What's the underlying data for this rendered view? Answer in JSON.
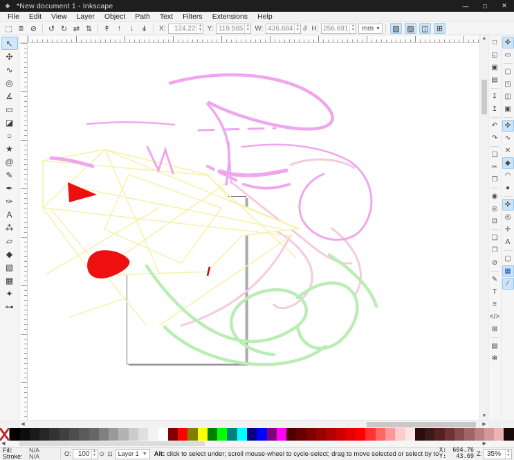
{
  "window": {
    "title": "*New document 1 - Inkscape",
    "controls": [
      {
        "name": "minimize",
        "glyph": "—"
      },
      {
        "name": "maximize",
        "glyph": "□"
      },
      {
        "name": "close",
        "glyph": "✕"
      }
    ]
  },
  "menu": {
    "items": [
      "File",
      "Edit",
      "View",
      "Layer",
      "Object",
      "Path",
      "Text",
      "Filters",
      "Extensions",
      "Help"
    ]
  },
  "toolbar": {
    "buttons": [
      {
        "name": "select-all",
        "glyph": "⬚"
      },
      {
        "name": "select-all-layers",
        "glyph": "⧈"
      },
      {
        "name": "deselect",
        "glyph": "⊘"
      },
      "|",
      {
        "name": "rotate-ccw",
        "glyph": "↺"
      },
      {
        "name": "rotate-cw",
        "glyph": "↻"
      },
      {
        "name": "flip-horizontal",
        "glyph": "⇄"
      },
      {
        "name": "flip-vertical",
        "glyph": "⇅"
      },
      "|",
      {
        "name": "raise-to-top",
        "glyph": "↟"
      },
      {
        "name": "raise",
        "glyph": "↑"
      },
      {
        "name": "lower",
        "glyph": "↓"
      },
      {
        "name": "lower-to-bottom",
        "glyph": "↡"
      }
    ],
    "x_label": "X:",
    "x_value": "124.22",
    "y_label": "Y:",
    "y_value": "119.565",
    "w_label": "W:",
    "w_value": "436.684",
    "h_label": "H:",
    "h_value": "256.691",
    "lock_glyph": "∂",
    "units": "mm",
    "toggles": [
      {
        "name": "scale-stroke",
        "glyph": "▧"
      },
      {
        "name": "scale-corners",
        "glyph": "▨"
      },
      {
        "name": "move-gradients",
        "glyph": "◫"
      },
      {
        "name": "move-patterns",
        "glyph": "⊞"
      }
    ]
  },
  "toolbox": {
    "tools": [
      {
        "name": "selector",
        "glyph": "↖",
        "active": true
      },
      {
        "name": "node-editor",
        "glyph": "✣"
      },
      {
        "name": "tweak",
        "glyph": "∿"
      },
      {
        "name": "zoom",
        "glyph": "◎"
      },
      {
        "name": "measure",
        "glyph": "∡"
      },
      {
        "name": "rectangle",
        "glyph": "▭"
      },
      {
        "name": "box-3d",
        "glyph": "◪"
      },
      {
        "name": "ellipse",
        "glyph": "○"
      },
      {
        "name": "star",
        "glyph": "★"
      },
      {
        "name": "spiral",
        "glyph": "@"
      },
      {
        "name": "pencil",
        "glyph": "✎"
      },
      {
        "name": "bezier-pen",
        "glyph": "✒"
      },
      {
        "name": "calligraphy",
        "glyph": "✑"
      },
      {
        "name": "text",
        "glyph": "A"
      },
      {
        "name": "spray",
        "glyph": "⁂"
      },
      {
        "name": "eraser",
        "glyph": "▱"
      },
      {
        "name": "paint-bucket",
        "glyph": "◆"
      },
      {
        "name": "gradient",
        "glyph": "▧"
      },
      {
        "name": "mesh-gradient",
        "glyph": "▦"
      },
      {
        "name": "dropper",
        "glyph": "✦"
      },
      {
        "name": "connector",
        "glyph": "⊶"
      }
    ]
  },
  "right_commands": {
    "items": [
      {
        "name": "new-document",
        "glyph": "□"
      },
      {
        "name": "open-document",
        "glyph": "◱"
      },
      {
        "name": "save-document",
        "glyph": "▣"
      },
      {
        "name": "print",
        "glyph": "▤"
      },
      "|",
      {
        "name": "import",
        "glyph": "↧"
      },
      {
        "name": "export",
        "glyph": "↥"
      },
      "|",
      {
        "name": "undo",
        "glyph": "↶"
      },
      {
        "name": "redo",
        "glyph": "↷"
      },
      "|",
      {
        "name": "copy",
        "glyph": "❏"
      },
      {
        "name": "cut",
        "glyph": "✂"
      },
      {
        "name": "paste",
        "glyph": "❐"
      },
      "|",
      {
        "name": "zoom-to-selection",
        "glyph": "◉"
      },
      {
        "name": "zoom-to-drawing",
        "glyph": "◎"
      },
      {
        "name": "zoom-to-page",
        "glyph": "⊡"
      },
      "|",
      {
        "name": "duplicate",
        "glyph": "❑"
      },
      {
        "name": "create-clone",
        "glyph": "❒"
      },
      {
        "name": "unlink-clone",
        "glyph": "⊘"
      },
      "|",
      {
        "name": "fill-stroke-dialog",
        "glyph": "✎"
      },
      {
        "name": "text-dialog",
        "glyph": "T"
      },
      {
        "name": "layers-dialog",
        "glyph": "≡"
      },
      {
        "name": "xml-editor",
        "glyph": "</>"
      },
      {
        "name": "align-distribute",
        "glyph": "⊞"
      },
      "|",
      {
        "name": "document-properties",
        "glyph": "▤"
      },
      {
        "name": "preferences",
        "glyph": "✻"
      }
    ]
  },
  "snap_bar": {
    "items": [
      {
        "name": "snap-enabled",
        "glyph": "✜",
        "on": true
      },
      {
        "name": "snap-bounding-box",
        "glyph": "▭"
      },
      "|",
      {
        "name": "snap-bbox-edges",
        "glyph": "▢"
      },
      {
        "name": "snap-bbox-corners",
        "glyph": "◳"
      },
      {
        "name": "snap-bbox-edge-midpoints",
        "glyph": "◫"
      },
      {
        "name": "snap-bbox-centers",
        "glyph": "▣"
      },
      "|",
      {
        "name": "snap-nodes",
        "glyph": "✜",
        "on": true
      },
      {
        "name": "snap-paths",
        "glyph": "∿"
      },
      {
        "name": "snap-path-intersections",
        "glyph": "✕"
      },
      {
        "name": "snap-cusp-nodes",
        "glyph": "◆",
        "on": true
      },
      {
        "name": "snap-smooth-nodes",
        "glyph": "◠"
      },
      {
        "name": "snap-line-midpoints",
        "glyph": "●"
      },
      "|",
      {
        "name": "snap-others",
        "glyph": "✜",
        "on": true
      },
      {
        "name": "snap-object-centers",
        "glyph": "◎"
      },
      {
        "name": "snap-rotation-centers",
        "glyph": "✛"
      },
      {
        "name": "snap-text-baselines",
        "glyph": "A"
      },
      "|",
      {
        "name": "snap-page-border",
        "glyph": "▢"
      },
      {
        "name": "snap-grid",
        "glyph": "▦",
        "on": true,
        "cls": "snap-grid-g"
      },
      {
        "name": "snap-guides",
        "glyph": "∕",
        "on": true
      }
    ]
  },
  "palette": {
    "colors": [
      "none",
      "#000000",
      "#0d0d0d",
      "#1a1a1a",
      "#262626",
      "#333333",
      "#404040",
      "#4d4d4d",
      "#5a5a5a",
      "#666666",
      "#808080",
      "#999999",
      "#b3b3b3",
      "#cccccc",
      "#e0e0e0",
      "#f2f2f2",
      "#ffffff",
      "#800000",
      "#ff0000",
      "#808000",
      "#ffff00",
      "#008000",
      "#00ff00",
      "#008080",
      "#00ffff",
      "#000080",
      "#0000ff",
      "#800080",
      "#ff00ff",
      "#4d0000",
      "#660000",
      "#800000",
      "#990000",
      "#b30000",
      "#cc0000",
      "#e60000",
      "#ff0000",
      "#ff3333",
      "#ff6666",
      "#ff9999",
      "#ffcccc",
      "#ffe5e5",
      "#2b0d0d",
      "#3d1a1a",
      "#552222",
      "#6e3333",
      "#874d4d",
      "#a06666",
      "#b98080",
      "#d29999",
      "#ebb3b3",
      "#1a0a0a"
    ]
  },
  "statusbar": {
    "fill_label": "Fill:",
    "fill_value": "N/A",
    "stroke_label": "Stroke:",
    "stroke_value": "N/A",
    "opacity_label": "O:",
    "opacity_value": "100",
    "eye_icon": "⊙",
    "lock_icon": "⊡",
    "layer_value": "Layer 1",
    "message_prefix": "Alt:",
    "message": " click to select under; scroll mouse-wheel to cycle-select; drag to move selected or select by touch",
    "x_label": "X:",
    "x_value": "604.76",
    "y_label": "Y:",
    "y_value": "43.69",
    "z_label": "Z:",
    "zoom_value": "35%"
  },
  "colors": {
    "titlebar": "#1e1e1e",
    "accent-select": "#cde8ff",
    "toggle-on": "#cce4f7",
    "magenta": "#f0a6ee",
    "pink": "#f7c9dd",
    "yellow": "#f5f2b0",
    "green": "#b9edb3",
    "red": "#ee1010",
    "page-border": "#6e6e6e",
    "shadow": "#a8a8a8"
  }
}
